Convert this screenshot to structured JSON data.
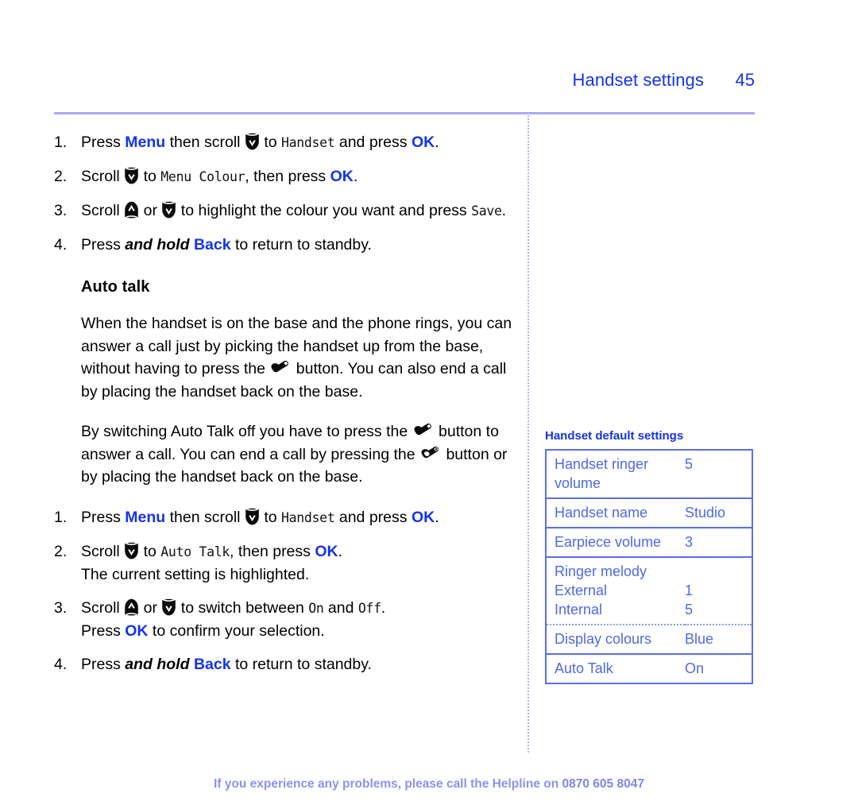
{
  "colors": {
    "link_blue": "#1433f0",
    "rule_lavender": "#a9a9fb",
    "table_blue": "#4f69e8",
    "table_border": "#5b6ee8",
    "footer_blue": "#8b93ef"
  },
  "header": {
    "title": "Handset settings",
    "page_number": "45"
  },
  "icons": {
    "scroll_down": "scroll-down-icon",
    "scroll_up": "scroll-up-icon",
    "talk": "talk-handset-icon",
    "end_call": "end-call-handset-icon"
  },
  "left_column": {
    "menu_colour_steps": [
      {
        "num": "1.",
        "parts": [
          {
            "t": "Press ",
            "s": "plain"
          },
          {
            "t": "Menu",
            "s": "blue"
          },
          {
            "t": " then scroll ",
            "s": "plain"
          },
          {
            "t": "scroll-down-icon",
            "s": "icon"
          },
          {
            "t": " to ",
            "s": "plain"
          },
          {
            "t": "Handset",
            "s": "lcd"
          },
          {
            "t": " and press ",
            "s": "plain"
          },
          {
            "t": "OK",
            "s": "blue"
          },
          {
            "t": ".",
            "s": "plain"
          }
        ]
      },
      {
        "num": "2.",
        "parts": [
          {
            "t": "Scroll ",
            "s": "plain"
          },
          {
            "t": "scroll-down-icon",
            "s": "icon"
          },
          {
            "t": " to ",
            "s": "plain"
          },
          {
            "t": "Menu Colour",
            "s": "lcd"
          },
          {
            "t": ", then press ",
            "s": "plain"
          },
          {
            "t": "OK",
            "s": "blue"
          },
          {
            "t": ".",
            "s": "plain"
          }
        ]
      },
      {
        "num": "3.",
        "parts": [
          {
            "t": "Scroll ",
            "s": "plain"
          },
          {
            "t": "scroll-up-icon",
            "s": "icon"
          },
          {
            "t": " or ",
            "s": "plain"
          },
          {
            "t": "scroll-down-icon",
            "s": "icon"
          },
          {
            "t": " to highlight the colour you want and press ",
            "s": "plain"
          },
          {
            "t": "Save",
            "s": "lcd"
          },
          {
            "t": ".",
            "s": "plain"
          }
        ]
      },
      {
        "num": "4.",
        "parts": [
          {
            "t": "Press ",
            "s": "plain"
          },
          {
            "t": "and hold",
            "s": "bolditalic"
          },
          {
            "t": " ",
            "s": "plain"
          },
          {
            "t": "Back",
            "s": "blue"
          },
          {
            "t": " to return to standby.",
            "s": "plain"
          }
        ]
      }
    ],
    "section_title": "Auto talk",
    "paragraphs": [
      [
        {
          "t": "When the handset is on the base and the phone rings, you can answer a call just by picking the handset up from the base, without having to press the ",
          "s": "plain"
        },
        {
          "t": "talk-handset-icon",
          "s": "icon"
        },
        {
          "t": " button. You can also end a call by placing the handset back on the base.",
          "s": "plain"
        }
      ],
      [
        {
          "t": "By switching Auto Talk off you have to press the ",
          "s": "plain"
        },
        {
          "t": "talk-handset-icon",
          "s": "icon"
        },
        {
          "t": " button to answer a call. You can end a call by pressing the ",
          "s": "plain"
        },
        {
          "t": "end-call-handset-icon",
          "s": "icon"
        },
        {
          "t": " button or by placing the handset back on the base.",
          "s": "plain"
        }
      ]
    ],
    "auto_talk_steps": [
      {
        "num": "1.",
        "parts": [
          {
            "t": "Press ",
            "s": "plain"
          },
          {
            "t": "Menu",
            "s": "blue"
          },
          {
            "t": " then scroll ",
            "s": "plain"
          },
          {
            "t": "scroll-down-icon",
            "s": "icon"
          },
          {
            "t": " to ",
            "s": "plain"
          },
          {
            "t": "Handset",
            "s": "lcd"
          },
          {
            "t": " and press ",
            "s": "plain"
          },
          {
            "t": "OK",
            "s": "blue"
          },
          {
            "t": ".",
            "s": "plain"
          }
        ]
      },
      {
        "num": "2.",
        "parts": [
          {
            "t": "Scroll ",
            "s": "plain"
          },
          {
            "t": "scroll-down-icon",
            "s": "icon"
          },
          {
            "t": " to ",
            "s": "plain"
          },
          {
            "t": "Auto Talk",
            "s": "lcd"
          },
          {
            "t": ", then press ",
            "s": "plain"
          },
          {
            "t": "OK",
            "s": "blue"
          },
          {
            "t": ".",
            "s": "plain"
          },
          {
            "t": "The current setting is highlighted.",
            "s": "newline"
          }
        ]
      },
      {
        "num": "3.",
        "parts": [
          {
            "t": "Scroll ",
            "s": "plain"
          },
          {
            "t": "scroll-up-icon",
            "s": "icon"
          },
          {
            "t": " or ",
            "s": "plain"
          },
          {
            "t": "scroll-down-icon",
            "s": "icon"
          },
          {
            "t": " to switch between ",
            "s": "plain"
          },
          {
            "t": "On",
            "s": "lcd"
          },
          {
            "t": " and ",
            "s": "plain"
          },
          {
            "t": "Off",
            "s": "lcd"
          },
          {
            "t": ".",
            "s": "plain"
          },
          {
            "t": "Press ",
            "s": "newline"
          },
          {
            "t": "OK",
            "s": "blue"
          },
          {
            "t": " to confirm your selection.",
            "s": "plain"
          }
        ]
      },
      {
        "num": "4.",
        "parts": [
          {
            "t": "Press ",
            "s": "plain"
          },
          {
            "t": "and hold",
            "s": "bolditalic"
          },
          {
            "t": " ",
            "s": "plain"
          },
          {
            "t": "Back",
            "s": "blue"
          },
          {
            "t": " to return to standby.",
            "s": "plain"
          }
        ]
      }
    ]
  },
  "right_column": {
    "table_caption": "Handset default settings",
    "table_rows": [
      {
        "label": "Handset ringer\nvolume",
        "value": "5",
        "dotted_below": false
      },
      {
        "label": "Handset name",
        "value": "Studio",
        "dotted_below": false
      },
      {
        "label": "Earpiece volume",
        "value": "3",
        "dotted_below": false
      },
      {
        "label": "Ringer melody\nExternal\nInternal",
        "value": "\n1\n5",
        "dotted_below": true
      },
      {
        "label": "Display colours",
        "value": "Blue",
        "dotted_below": false
      },
      {
        "label": "Auto Talk",
        "value": "On",
        "dotted_below": false
      }
    ]
  },
  "footer": {
    "text": "If you experience any problems, please call the Helpline on ",
    "phone": "0870 605 8047"
  }
}
